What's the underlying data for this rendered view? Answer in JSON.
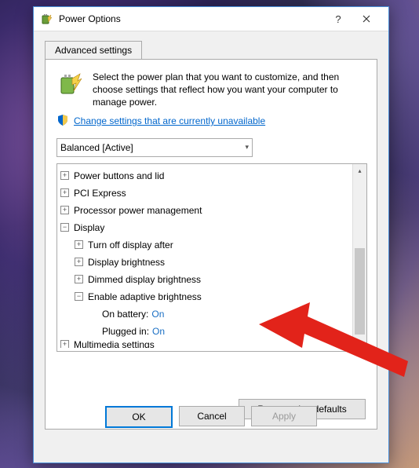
{
  "window": {
    "title": "Power Options"
  },
  "tab": {
    "label": "Advanced settings"
  },
  "intro": {
    "text": "Select the power plan that you want to customize, and then choose settings that reflect how you want your computer to manage power."
  },
  "shield": {
    "link": "Change settings that are currently unavailable"
  },
  "plan": {
    "selected": "Balanced [Active]"
  },
  "tree": {
    "items": [
      {
        "indent": 0,
        "exp": "plus",
        "label": "Power buttons and lid"
      },
      {
        "indent": 0,
        "exp": "plus",
        "label": "PCI Express"
      },
      {
        "indent": 0,
        "exp": "plus",
        "label": "Processor power management"
      },
      {
        "indent": 0,
        "exp": "minus",
        "label": "Display"
      },
      {
        "indent": 1,
        "exp": "plus",
        "label": "Turn off display after"
      },
      {
        "indent": 1,
        "exp": "plus",
        "label": "Display brightness"
      },
      {
        "indent": 1,
        "exp": "plus",
        "label": "Dimmed display brightness"
      },
      {
        "indent": 1,
        "exp": "minus",
        "label": "Enable adaptive brightness"
      },
      {
        "indent": 2,
        "exp": "none",
        "label": "On battery:",
        "value": "On"
      },
      {
        "indent": 2,
        "exp": "none",
        "label": "Plugged in:",
        "value": "On"
      },
      {
        "indent": 0,
        "exp": "plus",
        "label": "Multimedia settings",
        "cut": true
      }
    ]
  },
  "buttons": {
    "restore": "Restore plan defaults",
    "ok": "OK",
    "cancel": "Cancel",
    "apply": "Apply"
  }
}
